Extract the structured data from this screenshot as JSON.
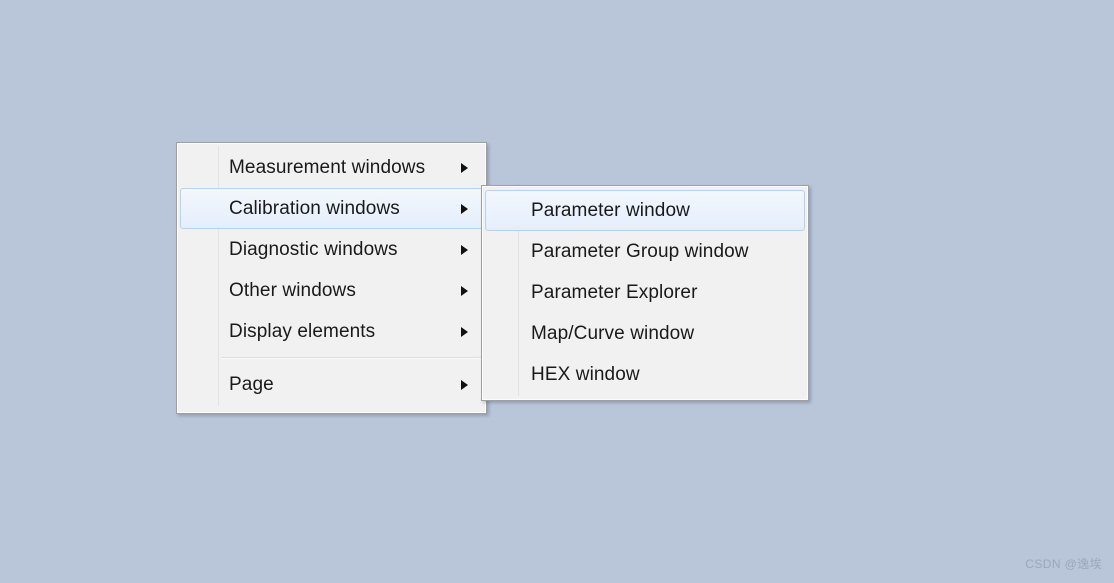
{
  "background_color": "#b9c6da",
  "menus": {
    "main": {
      "name": "context-menu-windows",
      "items": [
        {
          "label": "Measurement windows",
          "has_submenu": true,
          "selected": false,
          "separator_after": false
        },
        {
          "label": "Calibration windows",
          "has_submenu": true,
          "selected": true,
          "separator_after": false
        },
        {
          "label": "Diagnostic windows",
          "has_submenu": true,
          "selected": false,
          "separator_after": false
        },
        {
          "label": "Other windows",
          "has_submenu": true,
          "selected": false,
          "separator_after": false
        },
        {
          "label": "Display elements",
          "has_submenu": true,
          "selected": false,
          "separator_after": true
        },
        {
          "label": "Page",
          "has_submenu": true,
          "selected": false,
          "separator_after": false
        }
      ]
    },
    "submenu": {
      "name": "calibration-windows-submenu",
      "parent_label": "Calibration windows",
      "items": [
        {
          "label": "Parameter window",
          "has_submenu": false,
          "selected": true
        },
        {
          "label": "Parameter Group window",
          "has_submenu": false,
          "selected": false
        },
        {
          "label": "Parameter Explorer",
          "has_submenu": false,
          "selected": false
        },
        {
          "label": "Map/Curve window",
          "has_submenu": false,
          "selected": false
        },
        {
          "label": "HEX window",
          "has_submenu": false,
          "selected": false
        }
      ]
    }
  },
  "colors": {
    "menu_background": "#f1f1f1",
    "menu_border": "#a0a0a0",
    "highlight_fill": "#e4eefb",
    "highlight_border": "#b5d2f0",
    "text": "#1a1a1a",
    "separator": "#dedede"
  },
  "watermark": {
    "text": "CSDN @逸埃"
  }
}
